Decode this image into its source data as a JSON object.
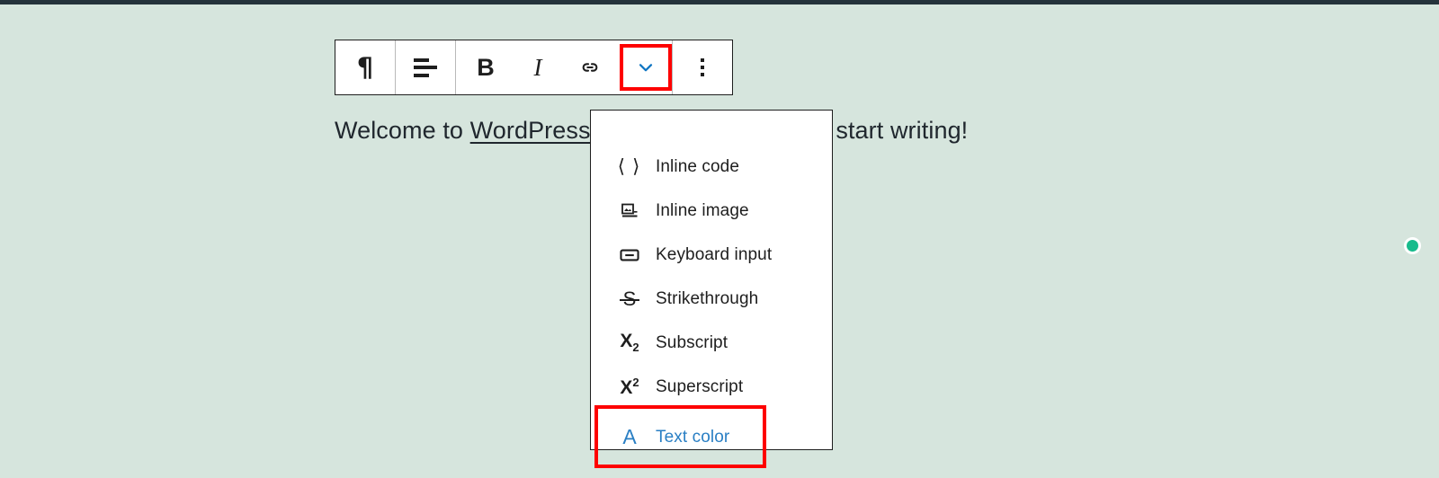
{
  "theme": {
    "canvas_background": "#d6e5dd",
    "admin_bar_color": "#25333b",
    "highlight_color": "#fe0000",
    "accent_blue": "#2a7fc4",
    "text_color": "#20272e",
    "cursor_dot_color": "#18bb8c"
  },
  "editor": {
    "post_text_before_link": "Welcome to ",
    "post_link_text": "WordPress",
    "post_text_after_link": ". Edit or delete it, then start writing!"
  },
  "toolbar": {
    "buttons": [
      {
        "name": "block-type-paragraph",
        "label": "¶",
        "icon": "paragraph-icon"
      },
      {
        "name": "align-text",
        "label": "",
        "icon": "align-icon"
      },
      {
        "name": "bold",
        "label": "B",
        "icon": "bold-icon"
      },
      {
        "name": "italic",
        "label": "I",
        "icon": "italic-icon"
      },
      {
        "name": "link",
        "label": "",
        "icon": "link-icon"
      },
      {
        "name": "more-rich-text",
        "label": "",
        "icon": "chevron-down-icon",
        "state": "active-highlighted"
      },
      {
        "name": "more-options",
        "label": "",
        "icon": "kebab-menu-icon"
      }
    ]
  },
  "dropdown": {
    "items": [
      {
        "label": "Inline code",
        "icon": "angle-brackets-icon",
        "selected": false
      },
      {
        "label": "Inline image",
        "icon": "inline-image-icon",
        "selected": false
      },
      {
        "label": "Keyboard input",
        "icon": "keyboard-icon",
        "selected": false
      },
      {
        "label": "Strikethrough",
        "icon": "strikethrough-icon",
        "selected": false
      },
      {
        "label": "Subscript",
        "icon": "subscript-icon",
        "selected": false
      },
      {
        "label": "Superscript",
        "icon": "superscript-icon",
        "selected": false
      },
      {
        "label": "Text color",
        "icon": "text-color-icon",
        "selected": true
      }
    ]
  }
}
